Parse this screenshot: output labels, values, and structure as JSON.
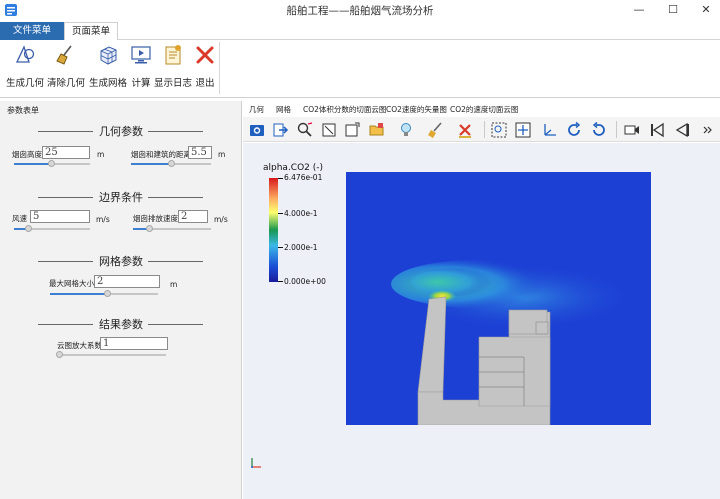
{
  "window": {
    "title": "船舶工程——船舶烟气流场分析",
    "controls": [
      "—",
      "☐",
      "✕"
    ]
  },
  "tabs": [
    "文件菜单",
    "页面菜单"
  ],
  "ribbon": [
    {
      "label": "生成几何",
      "icon": "geometry-icon"
    },
    {
      "label": "清除几何",
      "icon": "broom-icon"
    },
    {
      "label": "生成网格",
      "icon": "mesh-cube-icon"
    },
    {
      "label": "计算",
      "icon": "compute-monitor-icon"
    },
    {
      "label": "显示日志",
      "icon": "log-icon"
    },
    {
      "label": "退出",
      "icon": "exit-x-icon"
    }
  ],
  "left_panel": {
    "title": "参数表单",
    "geometry": {
      "heading": "几何参数",
      "chimney_height_label": "烟囱高度",
      "chimney_height": "25",
      "chimney_height_unit": "m",
      "distance_label": "烟囱和建筑的距离",
      "distance": "5.5",
      "distance_unit": "m"
    },
    "boundary": {
      "heading": "边界条件",
      "wind_label": "风速",
      "wind": "5",
      "wind_unit": "m/s",
      "emission_label": "烟囱排放速度",
      "emission": "2",
      "emission_unit": "m/s"
    },
    "mesh": {
      "heading": "网格参数",
      "max_mesh_label": "最大网格大小",
      "max_mesh": "2",
      "max_mesh_unit": "m"
    },
    "result": {
      "heading": "结果参数",
      "zoom_label": "云图放大系数",
      "zoom": "1"
    }
  },
  "view_tabs": [
    "几何",
    "网格",
    "CO2体积分数的切面云图",
    "CO2速度的矢量图",
    "CO2的速度切面云图"
  ],
  "toolbar_icons": [
    "camera-icon",
    "export-icon",
    "zoom-pick-icon",
    "reset-box-icon",
    "box-select-icon",
    "color-folder-icon",
    "light-bulb-icon",
    "brush-icon",
    "clear-x-icon",
    "zoom-region-icon",
    "fit-view-icon",
    "axes-icon",
    "rotate-cw-icon",
    "rotate-ccw-icon",
    "video-icon",
    "first-frame-icon",
    "prev-frame-icon",
    "more-icon"
  ],
  "plot": {
    "legend_title": "alpha.CO2 (-)",
    "ticks": [
      "6.476e-01",
      "4.000e-1",
      "2.000e-1",
      "0.000e+00"
    ],
    "colors": {
      "background": "#1c3fd4",
      "plume_high": "#f4e03a",
      "plume_mid": "#3dc9b8",
      "solid": "#c4c4c4"
    }
  }
}
